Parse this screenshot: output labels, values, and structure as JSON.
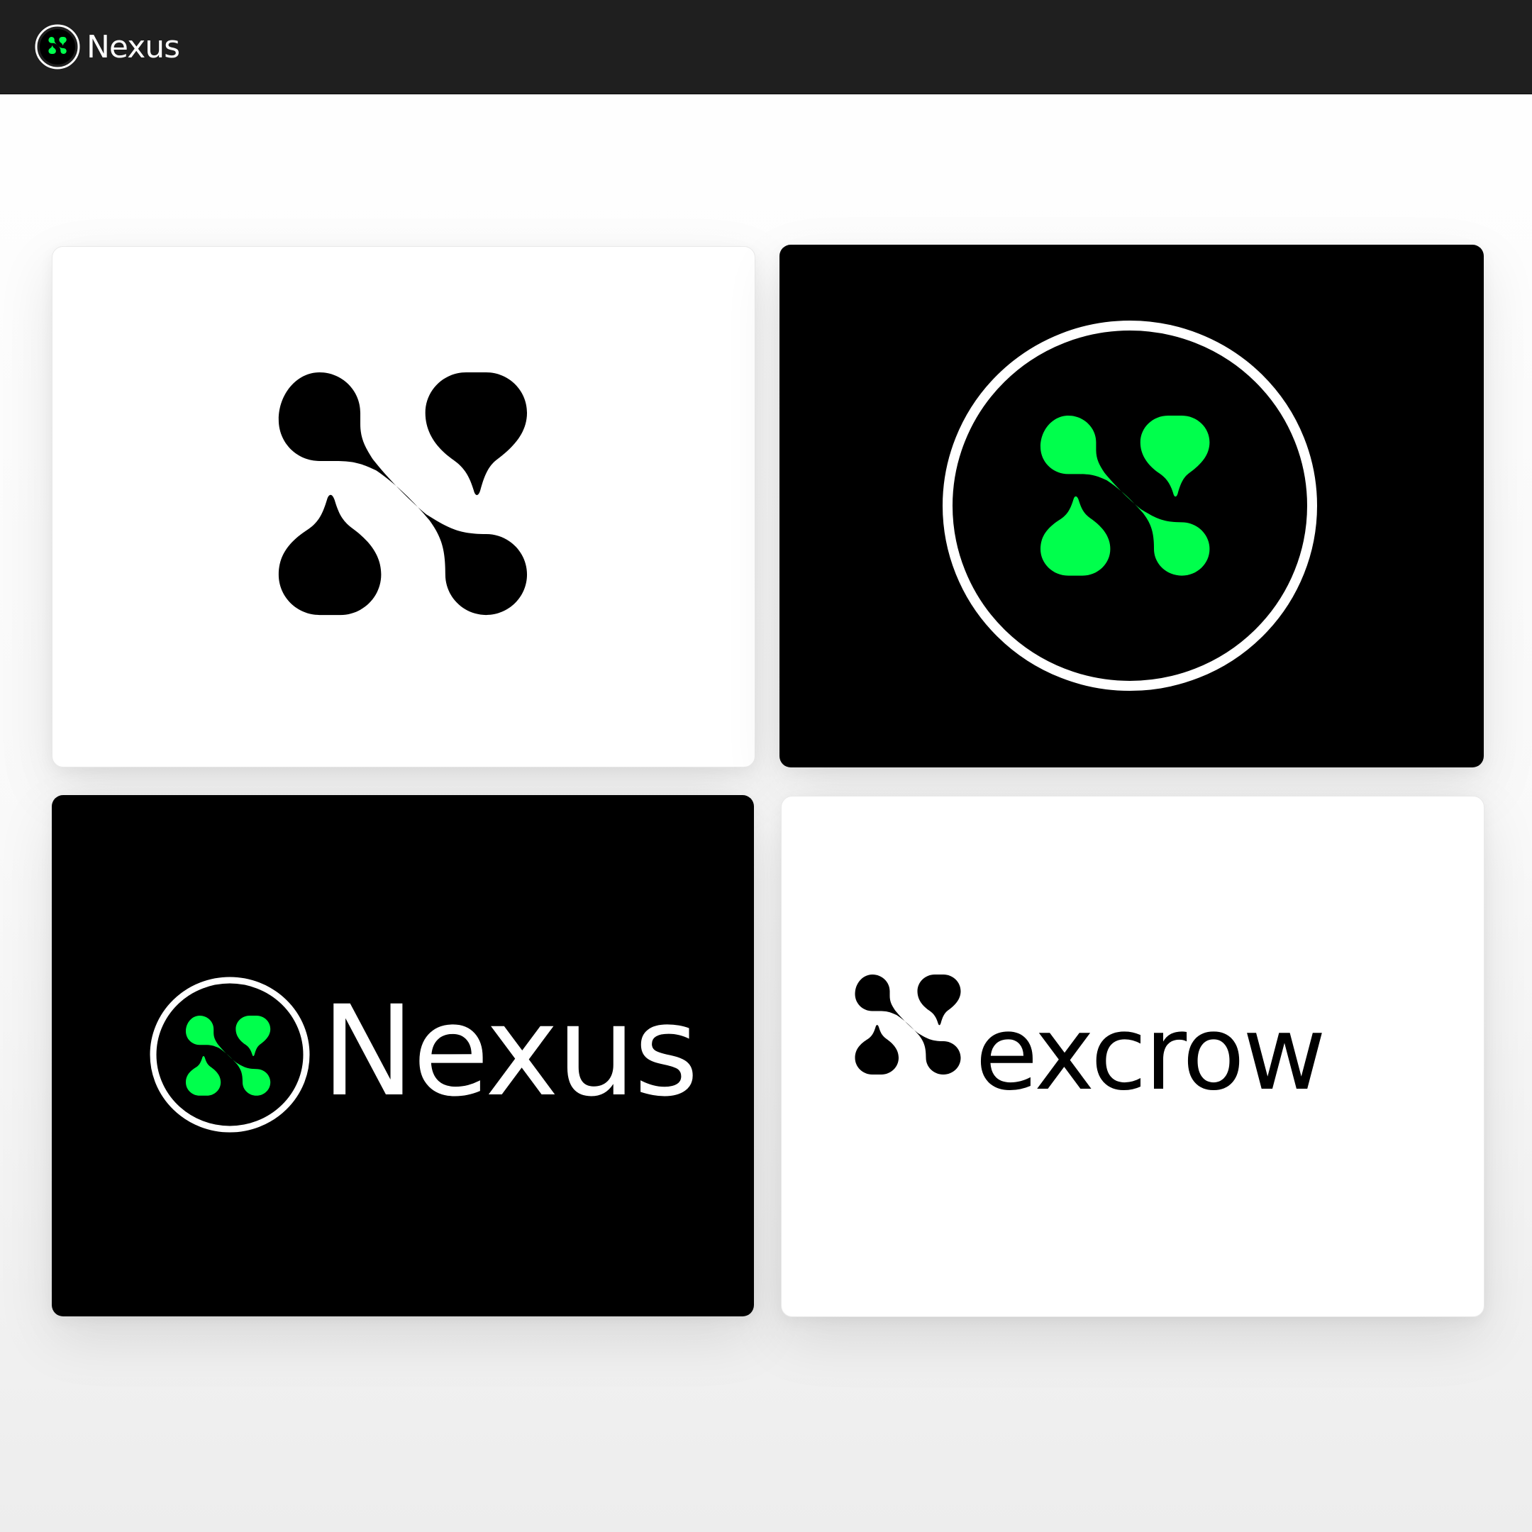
{
  "header": {
    "brand_name": "Nexus",
    "logo_icon": "nexus-logo-icon"
  },
  "colors": {
    "accent_green": "#00FF4C",
    "dark": "#000000",
    "light": "#FFFFFF",
    "topbar": "#1F1F1F"
  },
  "cards": [
    {
      "variant": "light",
      "content": "logo-mark-black"
    },
    {
      "variant": "dark",
      "content": "logo-mark-green-in-ring"
    },
    {
      "variant": "dark",
      "content": "logo-lockup",
      "wordmark": "Nexus"
    },
    {
      "variant": "light",
      "content": "logo-lockup",
      "wordmark": "excrow"
    }
  ]
}
